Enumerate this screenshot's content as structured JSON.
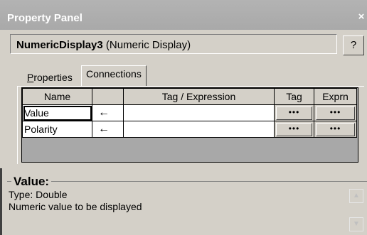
{
  "window": {
    "title": "Property Panel",
    "close_glyph": "×"
  },
  "object": {
    "name": "NumericDisplay3",
    "type": "(Numeric Display)"
  },
  "help_button": {
    "label": "?"
  },
  "tabs": [
    {
      "label_first": "P",
      "label_rest": "roperties",
      "active": false
    },
    {
      "label": "Connections",
      "active": true
    }
  ],
  "grid": {
    "columns": [
      "Name",
      "",
      "Tag / Expression",
      "Tag",
      "Exprn"
    ],
    "rows": [
      {
        "name": "Value",
        "direction": "←",
        "expression": "",
        "tag_button": "•••",
        "exprn_button": "•••",
        "selected": true
      },
      {
        "name": "Polarity",
        "direction": "←",
        "expression": "",
        "tag_button": "•••",
        "exprn_button": "•••",
        "selected": false
      }
    ]
  },
  "description": {
    "heading": "Value:",
    "type": "Type: Double",
    "text": "Numeric value to be displayed"
  },
  "colors": {
    "title_bar": "#acacac",
    "face": "#d4d0c8",
    "grid_empty": "#a8a8a8"
  }
}
